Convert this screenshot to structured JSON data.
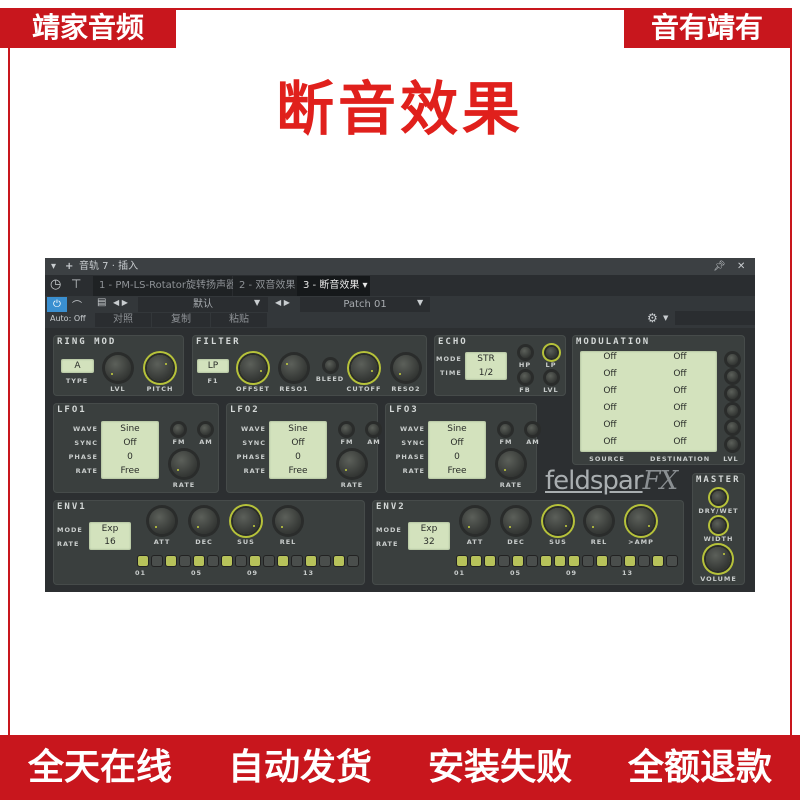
{
  "banner": {
    "left": "靖家音频",
    "right": "音有靖有",
    "title": "断音效果",
    "footer": [
      "全天在线",
      "自动发货",
      "安装失败",
      "全额退款"
    ]
  },
  "colors": {
    "brand_red": "#c8161d",
    "lcd": "#d3e2bd",
    "accent": "#b6c23a"
  },
  "host": {
    "header": "音轨 7 · 插入",
    "tabs": [
      "1 - PM-LS-Rotator旋转扬声器",
      "2 - 双音效果",
      "3 - 断音效果"
    ],
    "active_tab": 2,
    "preset": "默认",
    "patch": "Patch 01",
    "auto": "Auto: Off",
    "buttons": [
      "对照",
      "复制",
      "粘贴"
    ]
  },
  "ring_mod": {
    "title": "RING MOD",
    "type": "A",
    "labels": [
      "TYPE",
      "LVL",
      "PITCH"
    ]
  },
  "filter": {
    "title": "FILTER",
    "type": "LP",
    "type_label": "F1",
    "labels": [
      "OFFSET",
      "RESO1",
      "BLEED",
      "CUTOFF",
      "RESO2"
    ]
  },
  "echo": {
    "title": "ECHO",
    "mode_label": "MODE",
    "time_label": "TIME",
    "mode": "STR",
    "time": "1/2",
    "labels": [
      "HP",
      "LP",
      "FB",
      "LVL"
    ]
  },
  "modulation": {
    "title": "MODULATION",
    "rows": [
      [
        "Off",
        "Off"
      ],
      [
        "Off",
        "Off"
      ],
      [
        "Off",
        "Off"
      ],
      [
        "Off",
        "Off"
      ],
      [
        "Off",
        "Off"
      ],
      [
        "Off",
        "Off"
      ]
    ],
    "labels": [
      "SOURCE",
      "DESTINATION",
      "LVL"
    ]
  },
  "lfos": [
    {
      "title": "LFO1",
      "wave": "Sine",
      "sync": "Off",
      "phase": "0",
      "rate": "Free"
    },
    {
      "title": "LFO2",
      "wave": "Sine",
      "sync": "Off",
      "phase": "0",
      "rate": "Free"
    },
    {
      "title": "LFO3",
      "wave": "Sine",
      "sync": "Off",
      "phase": "0",
      "rate": "Free"
    }
  ],
  "lfo_labels": {
    "wave": "WAVE",
    "sync": "SYNC",
    "phase": "PHASE",
    "rate": "RATE",
    "fm": "FM",
    "am": "AM",
    "rate_knob": "RATE"
  },
  "envs": [
    {
      "title": "ENV1",
      "mode": "Exp",
      "rate": "16",
      "knobs": [
        "ATT",
        "DEC",
        "SUS",
        "REL"
      ],
      "steps": [
        1,
        0,
        1,
        0,
        1,
        0,
        1,
        0,
        1,
        0,
        1,
        0,
        1,
        0,
        1,
        0
      ]
    },
    {
      "title": "ENV2",
      "mode": "Exp",
      "rate": "32",
      "knobs": [
        "ATT",
        "DEC",
        "SUS",
        "REL",
        ">AMP"
      ],
      "steps": [
        1,
        1,
        1,
        0,
        1,
        0,
        1,
        1,
        1,
        0,
        1,
        0,
        1,
        0,
        1,
        0
      ]
    }
  ],
  "env_labels": {
    "mode": "MODE",
    "rate": "RATE",
    "step_marks": [
      "01",
      "05",
      "09",
      "13"
    ]
  },
  "master": {
    "title": "MASTER",
    "labels": [
      "DRY/WET",
      "WIDTH",
      "VOLUME"
    ]
  },
  "logo": {
    "text": "feldspar",
    "fx": "FX"
  }
}
